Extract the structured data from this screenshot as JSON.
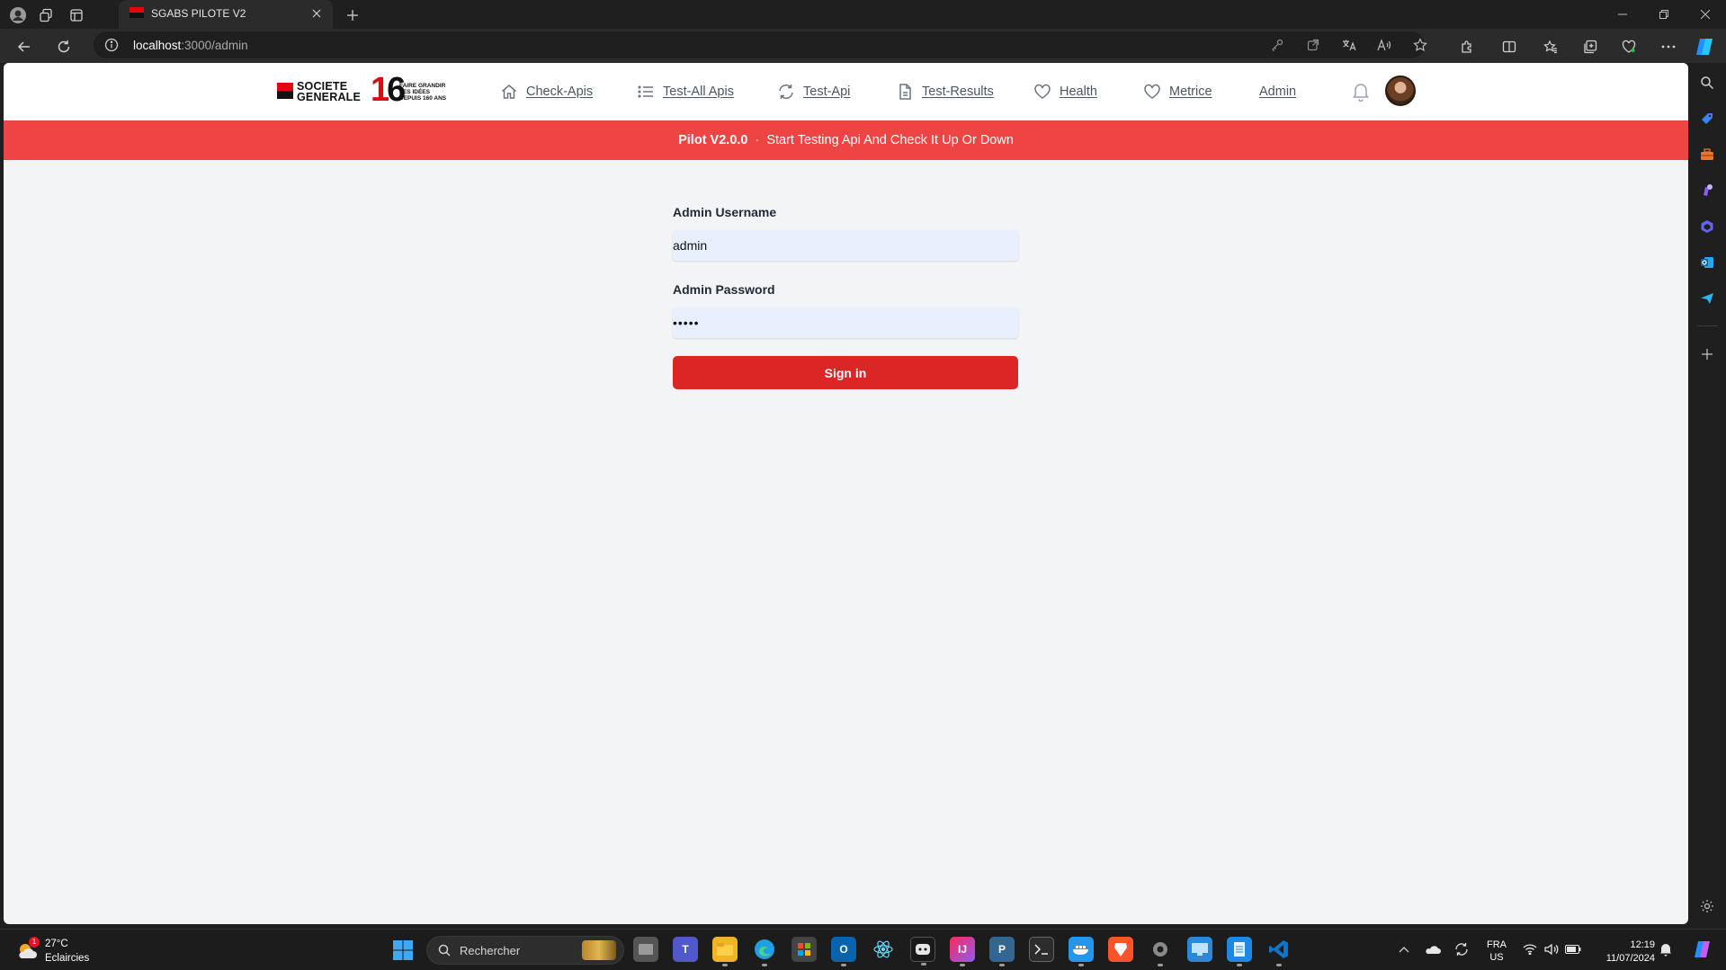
{
  "browser": {
    "tab_title": "SGABS PILOTE V2",
    "url_host": "localhost",
    "url_path": ":3000/admin"
  },
  "app": {
    "logo": {
      "brand_line1": "SOCIETE",
      "brand_line2": "GENERALE",
      "anniversary_digit1": "1",
      "anniversary_digit2": "6",
      "tagline_line1": "FAIRE GRANDIR",
      "tagline_line2": "LES IDÉES",
      "tagline_line3": "DEPUIS 160 ANS"
    },
    "nav": [
      {
        "label": "Check-Apis",
        "icon": "home-icon"
      },
      {
        "label": "Test-All Apis",
        "icon": "list-icon"
      },
      {
        "label": "Test-Api",
        "icon": "refresh-icon"
      },
      {
        "label": "Test-Results",
        "icon": "document-icon"
      },
      {
        "label": "Health",
        "icon": "heart-icon"
      },
      {
        "label": "Metrice",
        "icon": "heart-icon"
      },
      {
        "label": "Admin",
        "icon": ""
      }
    ],
    "banner": {
      "version": "Pilot V2.0.0",
      "separator": "·",
      "message": "Start Testing Api And Check It Up Or Down"
    },
    "form": {
      "username_label": "Admin Username",
      "username_value": "admin",
      "password_label": "Admin Password",
      "password_value": "•••••",
      "submit_label": "Sign in"
    }
  },
  "taskbar": {
    "weather_temp": "27°C",
    "weather_desc": "Eclaircies",
    "weather_badge": "1",
    "search_placeholder": "Rechercher",
    "lang_line1": "FRA",
    "lang_line2": "US",
    "time": "12:19",
    "date": "11/07/2024"
  },
  "colors": {
    "brand_red": "#e30613",
    "banner_red": "#ef4444",
    "button_red": "#dc2626",
    "input_fill": "#e8f0fe",
    "page_bg": "#f3f4f6"
  }
}
